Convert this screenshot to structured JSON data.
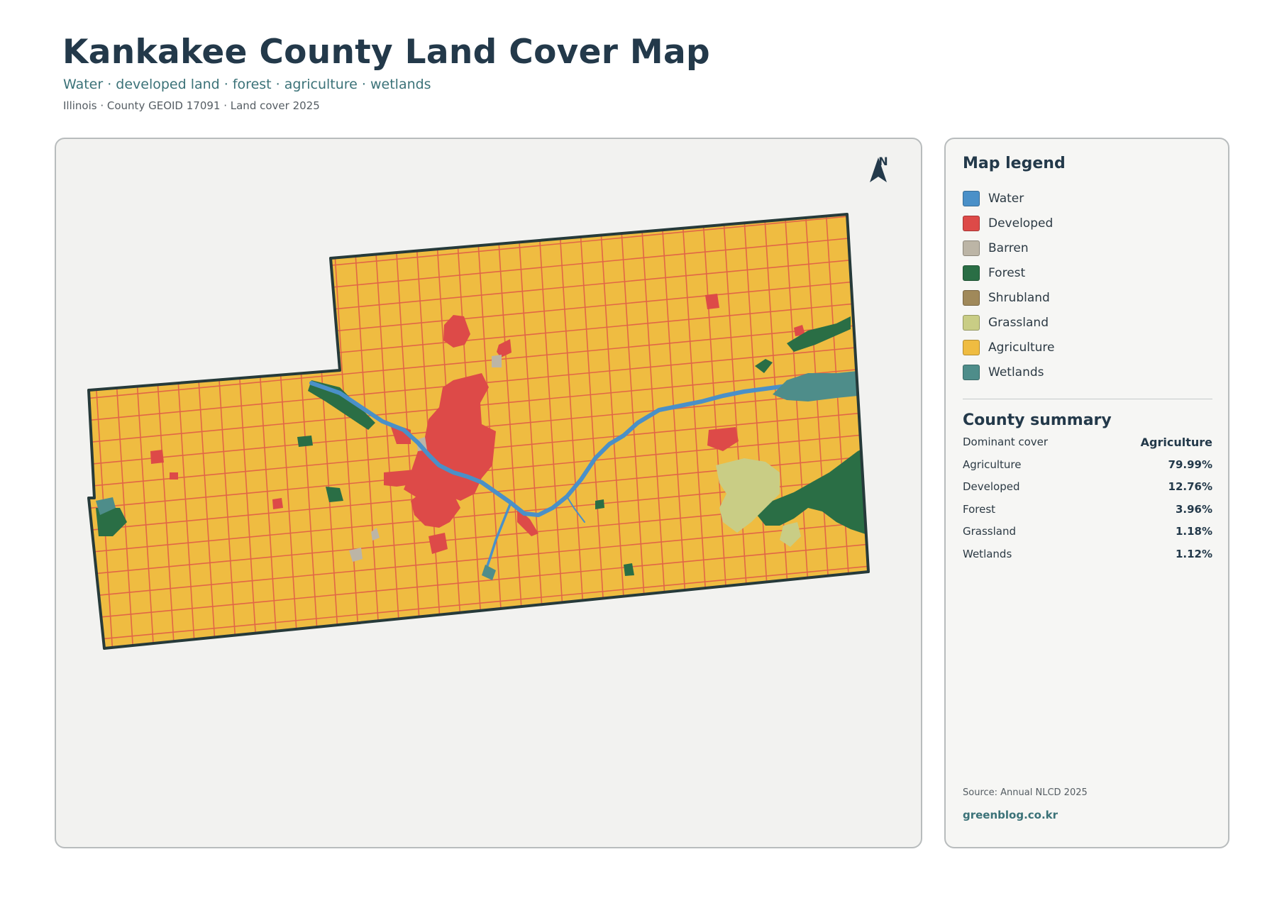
{
  "header": {
    "title": "Kankakee County Land Cover Map",
    "subtitle": "Water · developed land · forest · agriculture · wetlands",
    "meta": "Illinois · County GEOID 17091 · Land cover 2025"
  },
  "map": {
    "north_label": "N",
    "colors": {
      "water": "#4a90c8",
      "developed": "#dd4a48",
      "barren": "#bcb5a6",
      "forest": "#2a6e45",
      "shrubland": "#a0895a",
      "grassland": "#c9cd85",
      "agriculture": "#efbc41",
      "wetlands": "#4e8d8a",
      "boundary": "#263a3a"
    }
  },
  "legend": {
    "title": "Map legend",
    "items": [
      {
        "label": "Water",
        "color": "#4a90c8"
      },
      {
        "label": "Developed",
        "color": "#dd4a48"
      },
      {
        "label": "Barren",
        "color": "#bcb5a6"
      },
      {
        "label": "Forest",
        "color": "#2a6e45"
      },
      {
        "label": "Shrubland",
        "color": "#a0895a"
      },
      {
        "label": "Grassland",
        "color": "#c9cd85"
      },
      {
        "label": "Agriculture",
        "color": "#efbc41"
      },
      {
        "label": "Wetlands",
        "color": "#4e8d8a"
      }
    ]
  },
  "summary": {
    "title": "County summary",
    "rows": [
      {
        "label": "Dominant cover",
        "value": "Agriculture"
      },
      {
        "label": "Agriculture",
        "value": "79.99%"
      },
      {
        "label": "Developed",
        "value": "12.76%"
      },
      {
        "label": "Forest",
        "value": "3.96%"
      },
      {
        "label": "Grassland",
        "value": "1.18%"
      },
      {
        "label": "Wetlands",
        "value": "1.12%"
      }
    ]
  },
  "footer": {
    "source": "Source: Annual NLCD 2025",
    "site": "greenblog.co.kr"
  }
}
